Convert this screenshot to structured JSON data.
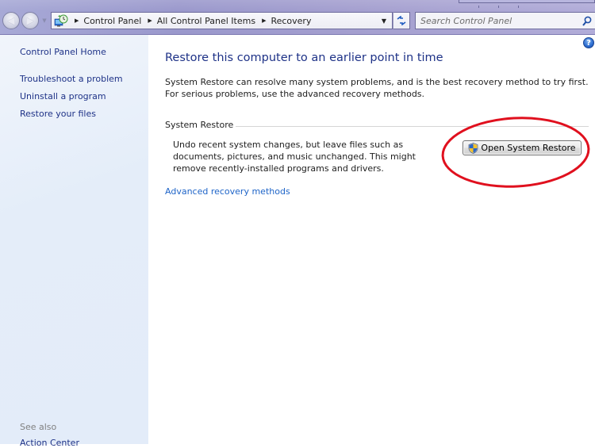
{
  "nav": {
    "back_label": "Back",
    "forward_label": "Forward"
  },
  "address_bar": {
    "breadcrumbs": [
      "Control Panel",
      "All Control Panel Items",
      "Recovery"
    ]
  },
  "search": {
    "placeholder": "Search Control Panel",
    "value": ""
  },
  "sidebar": {
    "home": "Control Panel Home",
    "links": [
      "Troubleshoot a problem",
      "Uninstall a program",
      "Restore your files"
    ],
    "see_also_heading": "See also",
    "see_also_items": [
      "Action Center"
    ]
  },
  "main": {
    "title": "Restore this computer to an earlier point in time",
    "intro": "System Restore can resolve many system problems, and is the best recovery method to try first. For serious problems, use the advanced recovery methods.",
    "group_label": "System Restore",
    "group_description": "Undo recent system changes, but leave files such as documents, pictures, and music unchanged. This might remove recently-installed programs and drivers.",
    "open_button_label": "Open System Restore",
    "advanced_link": "Advanced recovery methods",
    "help_glyph": "?"
  },
  "colors": {
    "link": "#1e3287",
    "accent_link": "#1e64c8",
    "annotation": "#e0101e"
  }
}
